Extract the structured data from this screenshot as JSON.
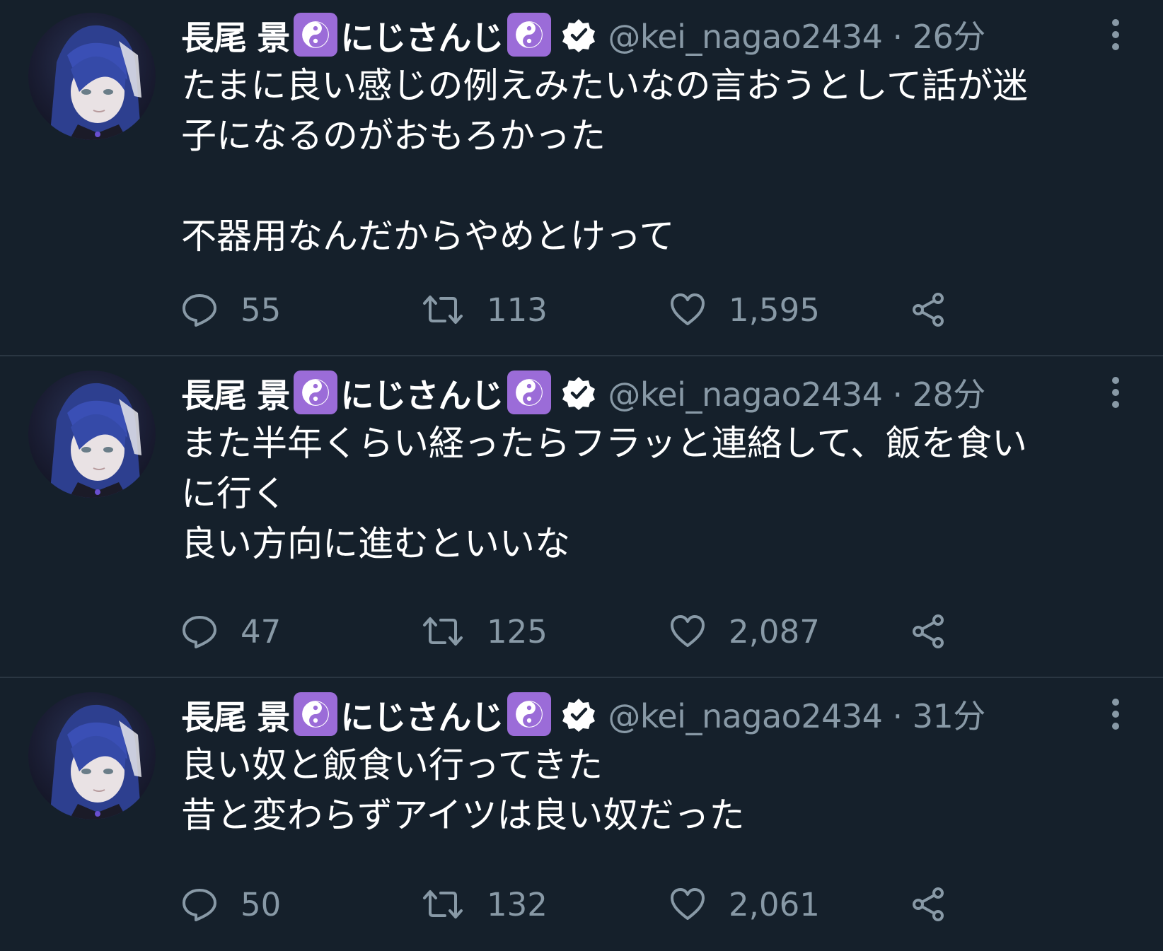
{
  "colors": {
    "background": "#15202b",
    "secondary_text": "#8899a6",
    "divider": "#2a3642",
    "emoji_purple": "#9b6cd8"
  },
  "tweets": [
    {
      "name_part1": "長尾 景",
      "name_part2": "にじさんじ",
      "handle_time": "@kei_nagao2434 · 26分",
      "lines": [
        "たまに良い感じの例えみたいなの言おうとして話が迷",
        "子になるのがおもろかった",
        "",
        "不器用なんだからやめとけって"
      ],
      "replies": "55",
      "retweets": "113",
      "likes": "1,595"
    },
    {
      "name_part1": "長尾 景",
      "name_part2": "にじさんじ",
      "handle_time": "@kei_nagao2434 · 28分",
      "lines": [
        "また半年くらい経ったらフラッと連絡して、飯を食い",
        "に行く",
        "良い方向に進むといいな"
      ],
      "replies": "47",
      "retweets": "125",
      "likes": "2,087"
    },
    {
      "name_part1": "長尾 景",
      "name_part2": "にじさんじ",
      "handle_time": "@kei_nagao2434 · 31分",
      "lines": [
        "良い奴と飯食い行ってきた",
        "昔と変わらずアイツは良い奴だった"
      ],
      "replies": "50",
      "retweets": "132",
      "likes": "2,061"
    }
  ],
  "icons": {
    "emoji": "yin-yang",
    "verified": "verified-badge",
    "more": "vertical-ellipsis",
    "reply": "speech-bubble",
    "retweet": "retweet-arrows",
    "like": "heart-outline",
    "share": "share-nodes"
  }
}
